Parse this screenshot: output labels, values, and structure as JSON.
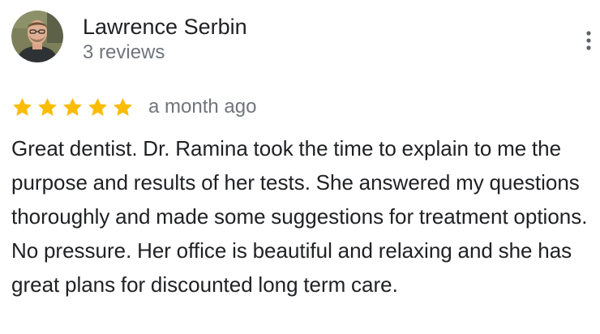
{
  "review": {
    "author": {
      "name": "Lawrence Serbin",
      "reviews_count": "3 reviews",
      "avatar_icon": "user-photo"
    },
    "menu_icon": "more-vertical-icon",
    "rating": 5,
    "rating_max": 5,
    "star_color": "#fbbc04",
    "date": "a month ago",
    "text": "Great dentist. Dr. Ramina took the time to explain to me the purpose and results of her tests. She answered my questions thoroughly and made some suggestions for treatment options. No pressure. Her office is beautiful and relaxing and she has great plans for discounted long term care."
  }
}
